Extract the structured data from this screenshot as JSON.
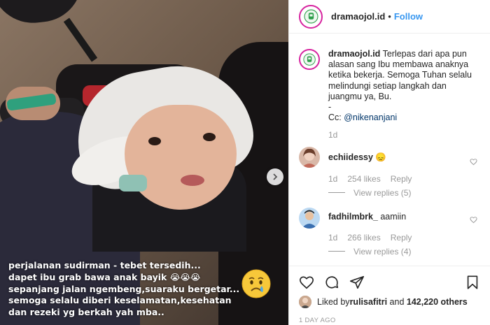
{
  "post": {
    "account": "dramaojol.id",
    "separator": "•",
    "follow_label": "Follow",
    "media": {
      "next_icon": "chevron-right-icon",
      "overlay_lines": [
        "perjalanan sudirman - tebet tersedih...",
        "dapet ibu grab bawa anak bayik 😭😭😭",
        "sepanjang jalan ngembeng,suaraku bergetar...",
        "semoga selalu diberi keselamatan,kesehatan",
        "dan rezeki yg berkah yah mba.."
      ],
      "sticker_icon": "crying-face-icon"
    },
    "caption": {
      "user": "dramaojol.id",
      "lines": [
        "Terlepas dari apa pun",
        "alasan sang Ibu membawa anaknya",
        "ketika bekerja. Semoga Tuhan selalu",
        "melindungi setiap langkah dan",
        "juangmu ya, Bu.",
        "-"
      ],
      "cc_prefix": "Cc: ",
      "mention": "@nikenanjani",
      "time": "1d"
    },
    "comments": [
      {
        "user": "echiidessy",
        "text": "😞",
        "time": "1d",
        "likes": "254 likes",
        "reply_label": "Reply",
        "view_replies": "View replies (5)"
      },
      {
        "user": "fadhilmbrk_",
        "text": "aamiin",
        "time": "1d",
        "likes": "266 likes",
        "reply_label": "Reply",
        "view_replies": "View replies (4)"
      }
    ],
    "actions": {
      "icons": [
        "heart-icon",
        "comment-icon",
        "share-icon",
        "bookmark-icon"
      ]
    },
    "liked_by": {
      "prefix": "Liked by ",
      "user": "rulisafitri",
      "middle": " and ",
      "others": "142,220 others"
    },
    "timestamp": "1 DAY AGO",
    "colors": {
      "link": "#3897f0",
      "text": "#262626",
      "muted": "#999999",
      "avatar_ring": "#d6249f"
    }
  }
}
